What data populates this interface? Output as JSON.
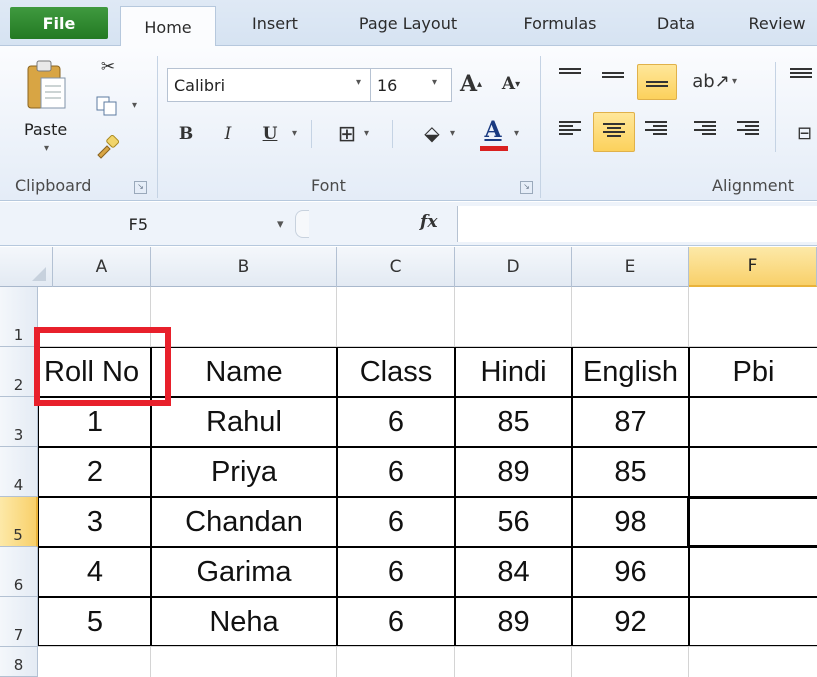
{
  "tabs": [
    "File",
    "Home",
    "Insert",
    "Page Layout",
    "Formulas",
    "Data",
    "Review"
  ],
  "ribbon": {
    "clipboard": {
      "paste_label": "Paste",
      "group_label": "Clipboard"
    },
    "font": {
      "font_name": "Calibri",
      "font_size": "16",
      "group_label": "Font",
      "bold": "B",
      "italic": "I",
      "underline": "U",
      "grow": "A",
      "shrink": "A",
      "font_color": "A",
      "font_color_hex": "#d92020"
    },
    "alignment": {
      "group_label": "Alignment"
    }
  },
  "formula_bar": {
    "name_box": "F5",
    "fx": "fx",
    "value": ""
  },
  "columns": [
    "A",
    "B",
    "C",
    "D",
    "E",
    "F"
  ],
  "selected_column": "F",
  "rows": [
    "1",
    "2",
    "3",
    "4",
    "5",
    "6",
    "7",
    "8"
  ],
  "selected_row": "5",
  "table": {
    "headers": [
      "Roll No",
      "Name",
      "Class",
      "Hindi",
      "English",
      "Pbi"
    ],
    "records": [
      [
        "1",
        "Rahul",
        "6",
        "85",
        "87",
        ""
      ],
      [
        "2",
        "Priya",
        "6",
        "89",
        "85",
        ""
      ],
      [
        "3",
        "Chandan",
        "6",
        "56",
        "98",
        ""
      ],
      [
        "4",
        "Garima",
        "6",
        "84",
        "96",
        ""
      ],
      [
        "5",
        "Neha",
        "6",
        "89",
        "92",
        ""
      ]
    ]
  },
  "annotation_color": "#e8202b"
}
